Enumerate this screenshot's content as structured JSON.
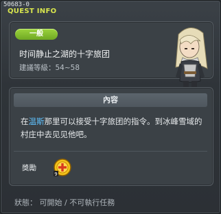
{
  "header": {
    "quest_id": "50683-0",
    "title": "QUEST INFO"
  },
  "quest": {
    "category": "一般",
    "name": "时间静止之湖的十字旅团",
    "level_label": "建議等級：54~58"
  },
  "content": {
    "header": "內容",
    "desc_before": "在",
    "desc_highlight": "温斯",
    "desc_after": "那里可以接受十字旅团的指令。到冰峰雪域的村庄中去见见他吧。"
  },
  "reward": {
    "label": "獎勵"
  },
  "status": {
    "text": "狀態： 可開始 / 不可執行任務"
  },
  "colors": {
    "accent": "#d9e64d",
    "tag": "#7fbf2c",
    "highlight": "#5fc2ff"
  },
  "icons": {
    "npc": "npc-portrait",
    "reward": "reward-coin-icon"
  }
}
